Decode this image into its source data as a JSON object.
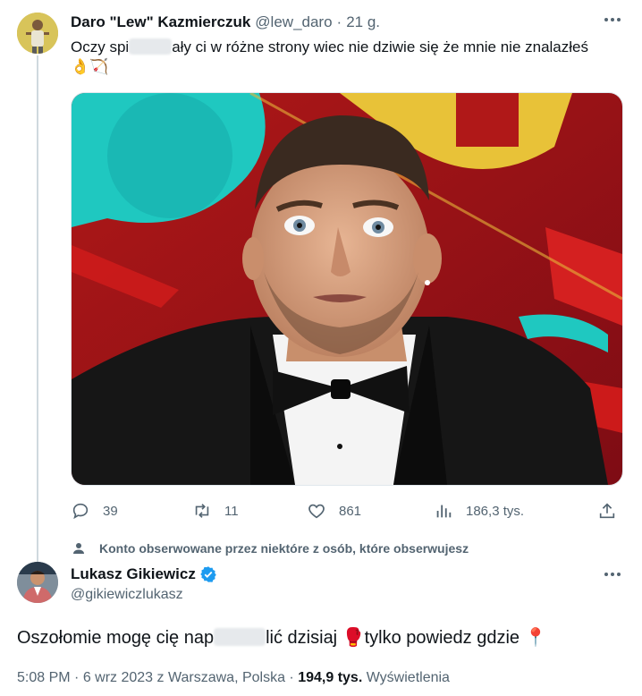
{
  "tweet1": {
    "author_name": "Daro \"Lew\" Kazmierczuk",
    "handle": "@lew_daro",
    "separator": "·",
    "time": "21 g.",
    "text_before": "Oczy spi",
    "text_after": "ały ci w różne strony wiec nie dziwie się że mnie nie znalazłeś",
    "emoji_line": "👌🏹",
    "actions": {
      "replies": "39",
      "retweets": "11",
      "likes": "861",
      "views": "186,3 tys."
    }
  },
  "social_context": "Konto obserwowane przez niektóre z osób, które obserwujesz",
  "tweet2": {
    "author_name": "Lukasz Gikiewicz",
    "handle": "@gikiewiczlukasz",
    "text_before": "Oszołomie mogę cię nap",
    "text_after": "lić dzisiaj 🥊tylko powiedz gdzie 📍",
    "time": "5:08 PM",
    "date": "6 wrz 2023",
    "location": "z Warszawa, Polska",
    "views_count": "194,9 tys.",
    "views_label": "Wyświetlenia"
  },
  "colors": {
    "accent": "#1d9bf0",
    "muted": "#536471",
    "text": "#0f1419"
  }
}
